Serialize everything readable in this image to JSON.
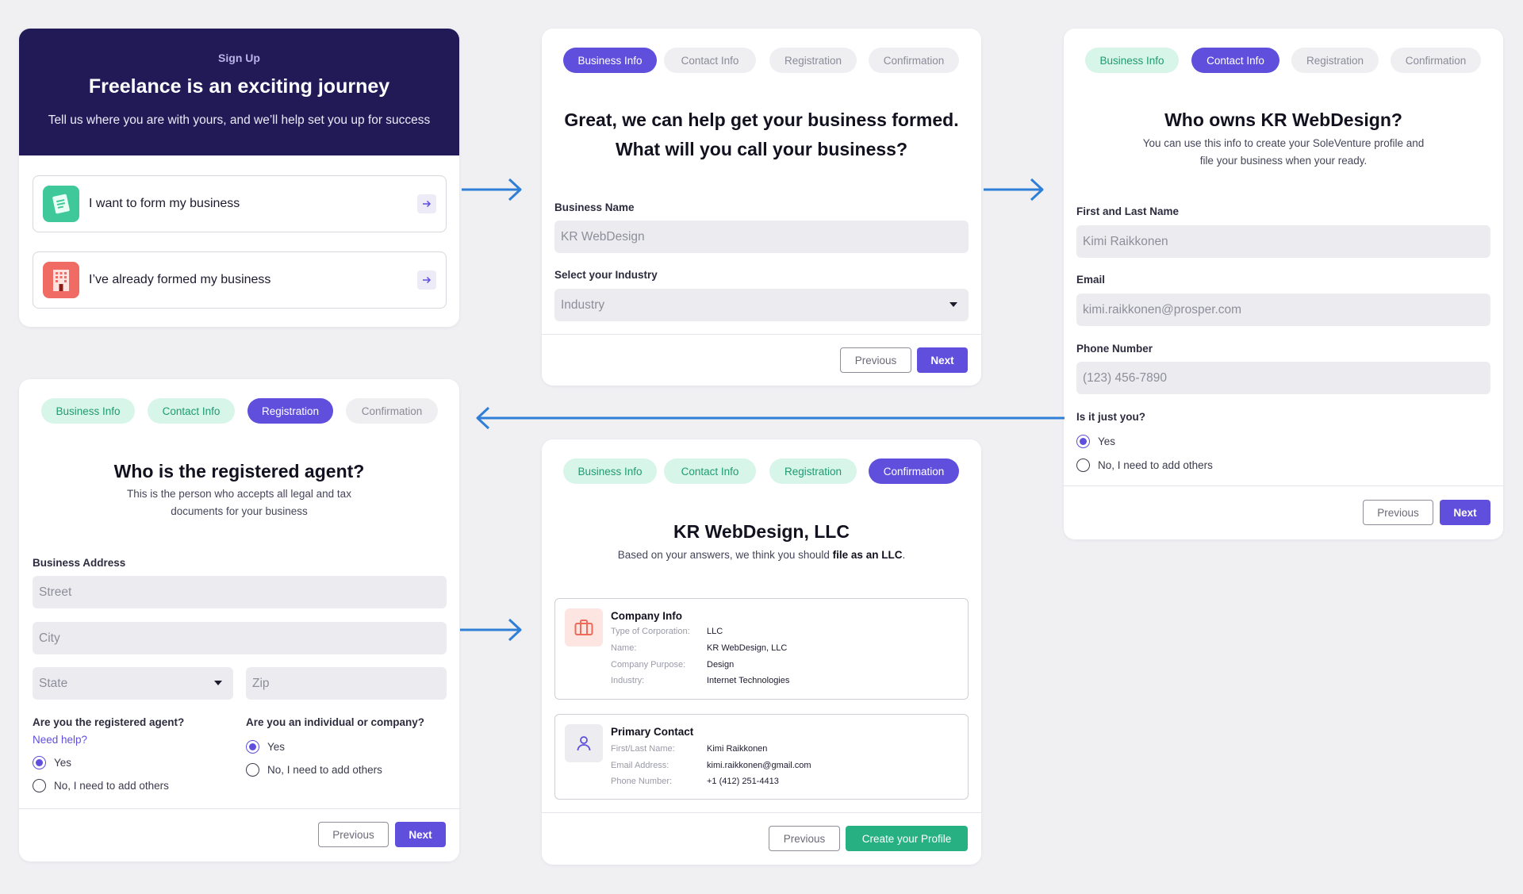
{
  "colors": {
    "background": "#f0f0f3",
    "header_navy": "#221a57",
    "primary": "#5f4fdc",
    "done_bg": "#d8f5ea",
    "done_text": "#1e9b72",
    "connector_blue": "#2f7fd6",
    "create_green": "#27b081"
  },
  "signup": {
    "eyebrow": "Sign Up",
    "title": "Freelance is an exciting journey",
    "subtitle": "Tell us where you are with yours, and we’ll help set you up for success",
    "options": [
      {
        "label": "I want to form my business",
        "icon": "document-icon"
      },
      {
        "label": "I’ve already formed my business",
        "icon": "building-icon"
      }
    ]
  },
  "steps": [
    "Business Info",
    "Contact Info",
    "Registration",
    "Confirmation"
  ],
  "business": {
    "title_line1": "Great, we can help get your business formed.",
    "title_line2": "What will you call your business?",
    "name_label": "Business Name",
    "name_value": "KR WebDesign",
    "industry_label": "Select your Industry",
    "industry_value": "Industry",
    "previous": "Previous",
    "next": "Next"
  },
  "contact": {
    "title": "Who owns KR WebDesign?",
    "subtitle_line1": "You can use this info to create your SoleVenture profile and",
    "subtitle_line2": "file your business when your ready.",
    "name_label": "First and Last Name",
    "name_value": "Kimi Raikkonen",
    "email_label": "Email",
    "email_value": "kimi.raikkonen@prosper.com",
    "phone_label": "Phone Number",
    "phone_value": "(123) 456-7890",
    "question": "Is it just you?",
    "yes": "Yes",
    "no": "No, I need to add others",
    "previous": "Previous",
    "next": "Next"
  },
  "registration": {
    "title": "Who is the registered agent?",
    "subtitle_line1": "This is the person who accepts all legal and tax",
    "subtitle_line2": "documents for your business",
    "address_label": "Business Address",
    "street": "Street",
    "city": "City",
    "state": "State",
    "zip": "Zip",
    "agent_question": "Are you the registered agent?",
    "help_link": "Need help?",
    "entity_question": "Are you an individual or company?",
    "yes": "Yes",
    "no": "No, I need to add others",
    "previous": "Previous",
    "next": "Next"
  },
  "confirmation": {
    "title": "KR WebDesign, LLC",
    "subtitle_prefix": "Based on your answers, we think you should ",
    "subtitle_bold": "file as an LLC",
    "subtitle_suffix": ".",
    "company": {
      "title": "Company Info",
      "rows": [
        {
          "key": "Type of Corporation:",
          "value": "LLC"
        },
        {
          "key": "Name:",
          "value": "KR WebDesign, LLC"
        },
        {
          "key": "Company Purpose:",
          "value": "Design"
        },
        {
          "key": "Industry:",
          "value": "Internet Technologies"
        }
      ]
    },
    "contact": {
      "title": "Primary Contact",
      "rows": [
        {
          "key": "First/Last Name:",
          "value": "Kimi Raikkonen"
        },
        {
          "key": "Email Address:",
          "value": "kimi.raikkonen@gmail.com"
        },
        {
          "key": "Phone Number:",
          "value": "+1 (412) 251-4413"
        }
      ]
    },
    "previous": "Previous",
    "create": "Create your Profile"
  }
}
